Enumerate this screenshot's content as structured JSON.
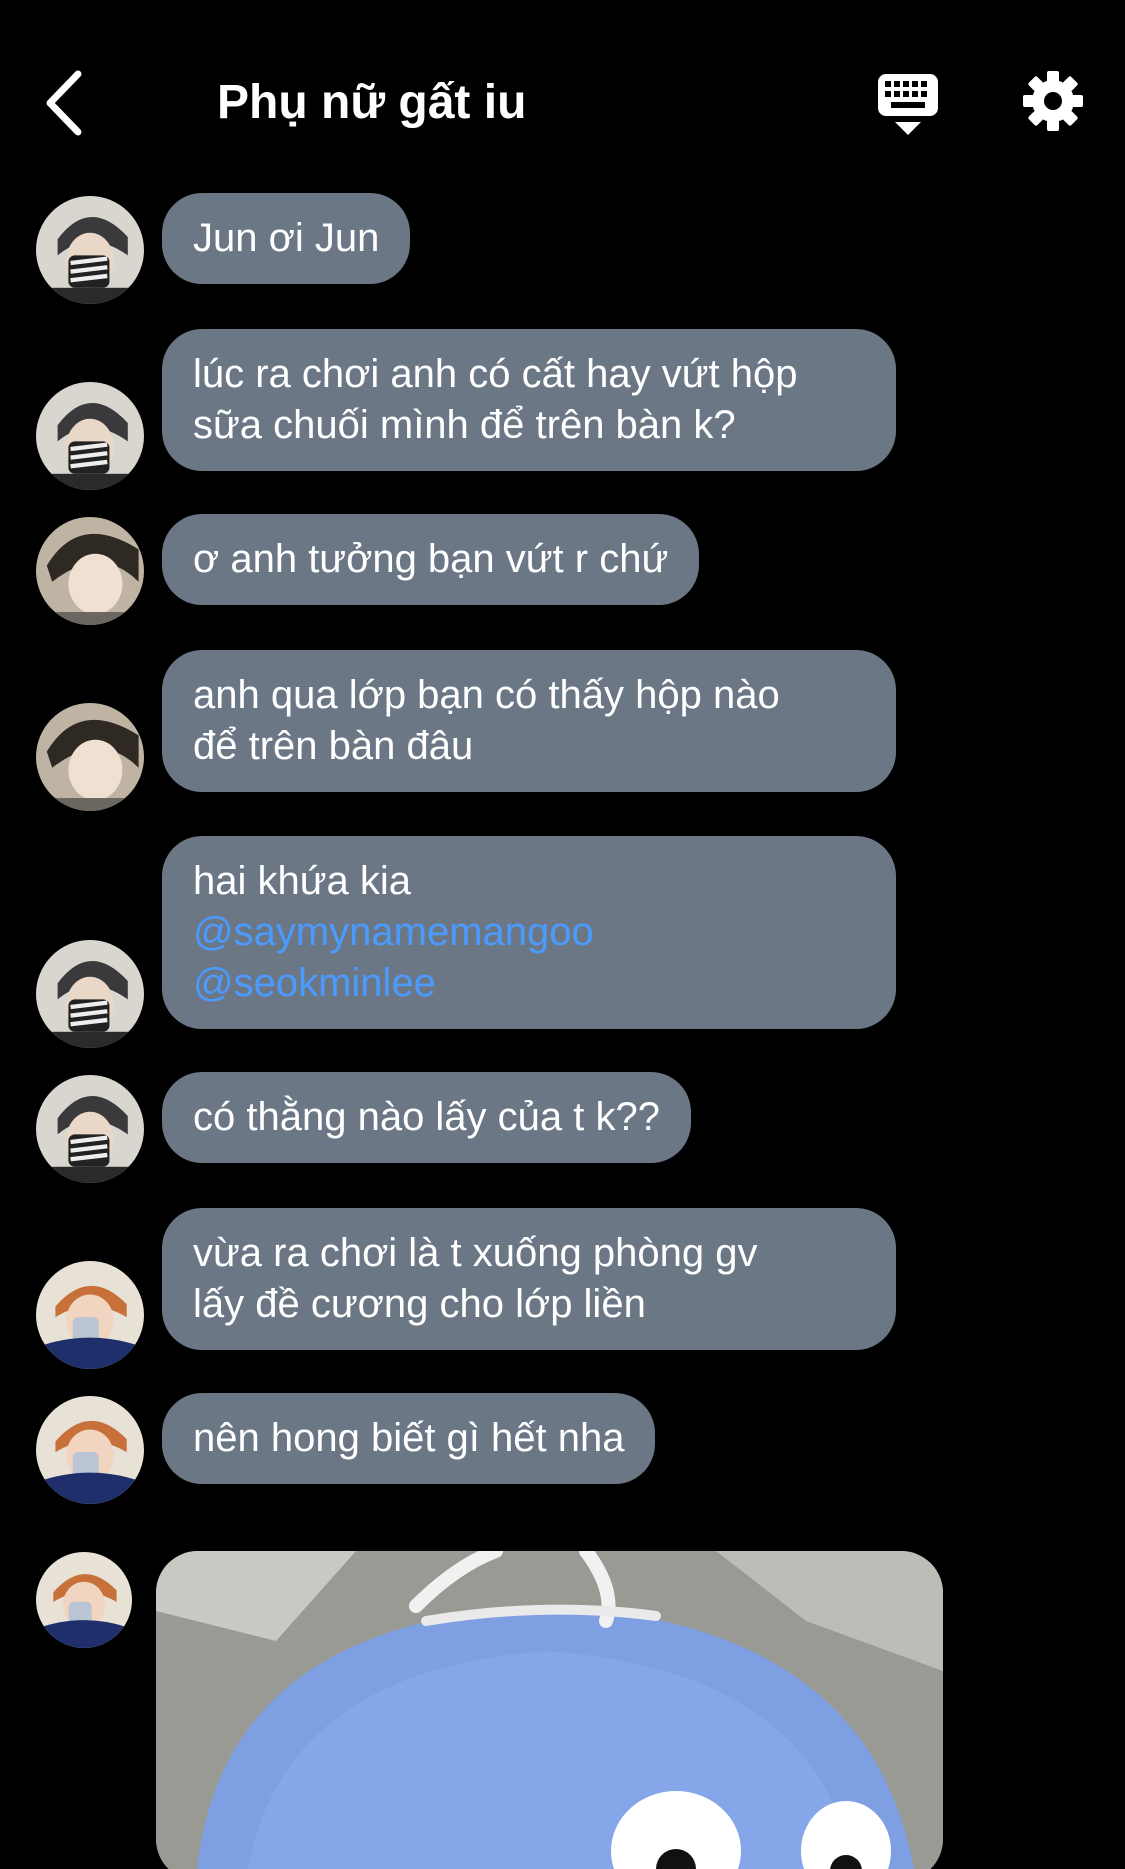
{
  "header": {
    "title": "Phụ nữ gất iu",
    "icons": {
      "back": "chevron-left-icon",
      "keyboard": "keyboard-hide-icon",
      "settings": "gear-icon"
    }
  },
  "colors": {
    "background": "#000000",
    "bubble": "#6b7785",
    "mention": "#4b9bff",
    "text": "#ffffff"
  },
  "messages": [
    {
      "avatar": "avatar-1",
      "lines": [
        "Jun ơi Jun"
      ]
    },
    {
      "avatar": "avatar-1",
      "lines": [
        "lúc ra chơi anh có cất hay vứt hộp",
        "sữa chuối mình để trên bàn k?"
      ]
    },
    {
      "avatar": "avatar-2",
      "lines": [
        "ơ anh tưởng bạn vứt r chứ"
      ]
    },
    {
      "avatar": "avatar-2",
      "lines": [
        "anh qua lớp bạn có thấy hộp nào",
        "để trên bàn đâu"
      ]
    },
    {
      "avatar": "avatar-1",
      "lines": [
        "hai khứa kia"
      ],
      "mentions": [
        "@saymynamemangoo",
        "@seokminlee"
      ]
    },
    {
      "avatar": "avatar-1",
      "lines": [
        "có thằng nào lấy của t k??"
      ]
    },
    {
      "avatar": "avatar-3",
      "lines": [
        "vừa ra chơi là t xuống phòng gv",
        "lấy đề cương cho lớp liền"
      ]
    },
    {
      "avatar": "avatar-3",
      "lines": [
        "nên hong biết gì hết nha"
      ]
    },
    {
      "avatar": "avatar-3",
      "type": "image"
    }
  ]
}
